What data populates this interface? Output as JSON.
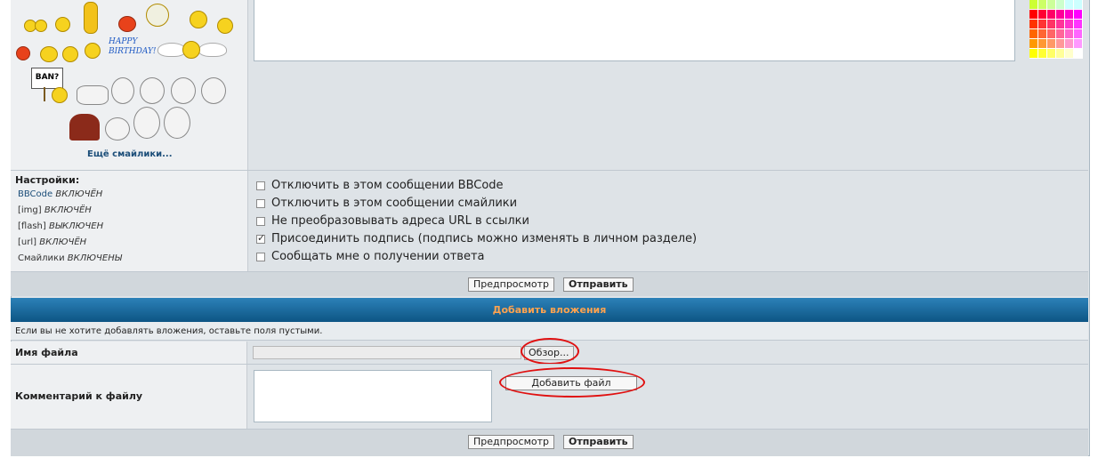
{
  "smileys": {
    "more_link": "Ещё смайлики...",
    "ban_sign": "BAN?",
    "birthday_line1": "HAPPY",
    "birthday_line2": "BIRTHDAY!"
  },
  "settings": {
    "title": "Настройки:",
    "items": [
      {
        "name": "BBCode",
        "state": "ВКЛЮЧЁН"
      },
      {
        "name": "[img]",
        "state": "ВКЛЮЧЁН"
      },
      {
        "name": "[flash]",
        "state": "ВЫКЛЮЧЕН"
      },
      {
        "name": "[url]",
        "state": "ВКЛЮЧЁН"
      },
      {
        "name": "Смайлики",
        "state": "ВКЛЮЧЕНЫ"
      }
    ],
    "options": [
      {
        "label": "Отключить в этом сообщении BBCode",
        "checked": false
      },
      {
        "label": "Отключить в этом сообщении смайлики",
        "checked": false
      },
      {
        "label": "Не преобразовывать адреса URL в ссылки",
        "checked": false
      },
      {
        "label": "Присоединить подпись (подпись можно изменять в личном разделе)",
        "checked": true
      },
      {
        "label": "Сообщать мне о получении ответа",
        "checked": false
      }
    ]
  },
  "buttons": {
    "preview": "Предпросмотр",
    "submit": "Отправить",
    "browse": "Обзор...",
    "add_file": "Добавить файл"
  },
  "attachments": {
    "header": "Добавить вложения",
    "hint": "Если вы не хотите добавлять вложения, оставьте поля пустыми.",
    "filename_label": "Имя файла",
    "comment_label": "Комментарий к файлу",
    "filename_value": ""
  },
  "colors": {
    "header_gradient_top": "#2c81b8",
    "header_gradient_bottom": "#0d5584",
    "header_text": "#ffa34f",
    "annotation": "#e01010"
  }
}
